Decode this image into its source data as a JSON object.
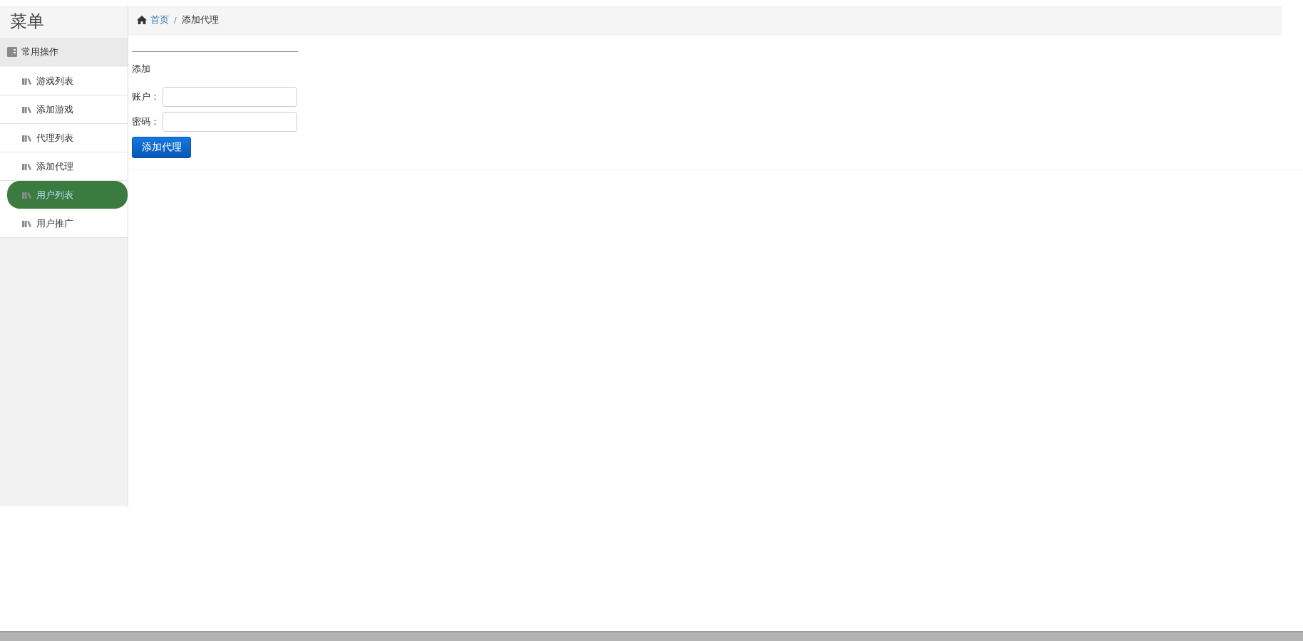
{
  "sidebar": {
    "title": "菜单",
    "section": {
      "label": "常用操作"
    },
    "items": [
      {
        "label": "游戏列表",
        "selected": false
      },
      {
        "label": "添加游戏",
        "selected": false
      },
      {
        "label": "代理列表",
        "selected": false
      },
      {
        "label": "添加代理",
        "selected": false
      },
      {
        "label": "用户列表",
        "selected": true
      },
      {
        "label": "用户推广",
        "selected": false
      }
    ]
  },
  "breadcrumb": {
    "separator": "/",
    "items": [
      {
        "label": "首页",
        "kind": "link"
      },
      {
        "label": "添加代理",
        "kind": "current"
      }
    ]
  },
  "form": {
    "heading": "添加",
    "fields": [
      {
        "label": "账户："
      },
      {
        "label": "密码："
      }
    ],
    "button": "添加代理"
  }
}
